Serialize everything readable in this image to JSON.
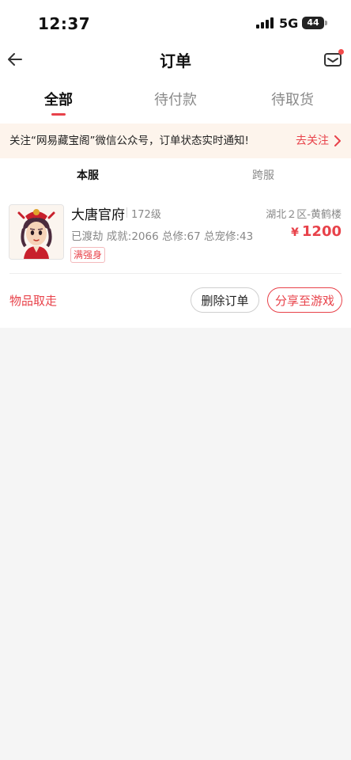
{
  "status_bar": {
    "time": "12:37",
    "network": "5G",
    "battery": "44",
    "icons": [
      "signal-icon",
      "battery-icon"
    ]
  },
  "nav": {
    "title": "订单",
    "back_icon": "back-arrow-icon",
    "mail_icon": "mail-icon"
  },
  "tabs": [
    {
      "label": "全部",
      "active": true
    },
    {
      "label": "待付款",
      "active": false
    },
    {
      "label": "待取货",
      "active": false
    }
  ],
  "notice": {
    "text": "关注“网易藏宝阁”微信公众号，订单状态实时通知!",
    "action": "去关注"
  },
  "server_tabs": [
    {
      "label": "本服",
      "active": true
    },
    {
      "label": "跨服",
      "active": false
    }
  ],
  "order": {
    "character_name": "大唐官府",
    "level": "172级",
    "server": "湖北２区-黄鹤楼",
    "stats": "已渡劫 成就:2066 总修:67 总宠修:43",
    "price_symbol": "¥",
    "price": "1200",
    "tag": "满强身",
    "status": "物品取走",
    "delete_label": "删除订单",
    "share_label": "分享至游戏"
  },
  "colors": {
    "accent": "#e8424a",
    "notice_bg": "#fdf4ec",
    "page_bg": "#f5f5f5"
  }
}
